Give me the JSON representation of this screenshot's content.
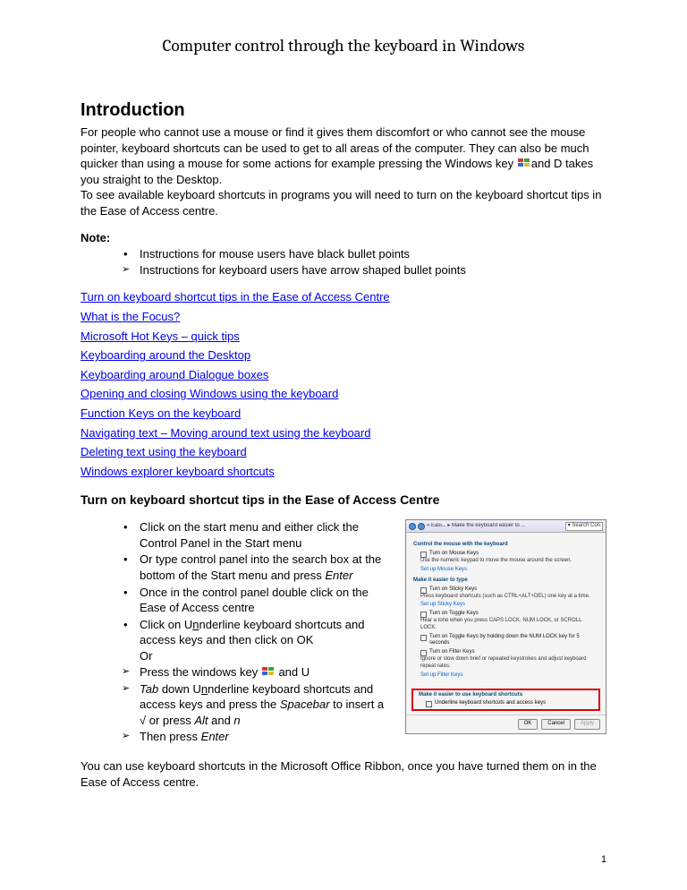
{
  "title": "Computer control through the keyboard in Windows",
  "intro_heading": "Introduction",
  "intro_p1_a": "For people who cannot use a mouse or find it gives them discomfort or who cannot see the mouse pointer, keyboard shortcuts can be used to get to all areas of the computer. They can also be much quicker than using a mouse for some actions for example pressing the Windows key ",
  "intro_p1_b": "and D takes you straight to the Desktop.",
  "intro_p2": "To see available keyboard shortcuts in programs you will need to turn on the keyboard shortcut tips in the Ease of Access centre.",
  "note_label": "Note:",
  "note_items": [
    "Instructions for mouse users have black bullet points",
    "Instructions for keyboard users have arrow shaped bullet points"
  ],
  "toc": [
    "Turn on keyboard shortcut tips in the Ease of Access Centre",
    "What is the Focus?",
    "Microsoft Hot Keys – quick tips",
    "Keyboarding around the Desktop",
    "Keyboarding around Dialogue boxes",
    "Opening and closing Windows using the keyboard",
    "Function Keys on the keyboard",
    "Navigating text – Moving around text using the keyboard",
    "Deleting text using the keyboard",
    "Windows explorer keyboard shortcuts"
  ],
  "section_heading": "Turn on keyboard shortcut tips in the Ease of Access Centre",
  "steps_mouse": {
    "s1": "Click on the start menu and either click  the Control Panel in the Start menu",
    "s2_a": "Or type control panel into the search box at the bottom of the Start menu and press ",
    "s2_b": "Enter",
    "s3": "Once in the control panel double click on the Ease of Access centre",
    "s4_a": "Click on U",
    "s4_b": "nderline  keyboard shortcuts and access keys and then click on OK",
    "s4_c": "Or"
  },
  "steps_kbd": {
    "s5_a": "Press the windows key ",
    "s5_b": " and U",
    "s6_a": "Tab",
    "s6_b": " down U",
    "s6_c": "nderline  keyboard shortcuts and access keys and press the  ",
    "s6_d": "Spacebar",
    "s6_e": " to insert a √ or press ",
    "s6_f": "Alt",
    "s6_g": " and ",
    "s6_h": "n",
    "s7_a": "Then press ",
    "s7_b": "Enter"
  },
  "screenshot": {
    "titlebar": "« Easi...  ▸  Make the keyboard easier to ...",
    "search": "Search Con",
    "g1": "Control the mouse with the keyboard",
    "g1_c": "Turn on Mouse Keys",
    "g1_d": "Use the numeric keypad to move the mouse around the screen.",
    "g1_l": "Set up Mouse Keys",
    "g2": "Make it easier to type",
    "g2_c": "Turn on Sticky Keys",
    "g2_d": "Press keyboard shortcuts (such as CTRL+ALT+DEL) one key at a time.",
    "g2_l": "Set up Sticky Keys",
    "g2_c2": "Turn on Toggle Keys",
    "g2_d2a": "Hear a tone when you press CAPS LOCK, NUM LOCK, or SCROLL LOCK.",
    "g2_d2b": "Turn on Toggle Keys by holding down the NUM LOCK key for 5 seconds",
    "g2_c3": "Turn on Filter Keys",
    "g2_d3": "Ignore or slow down brief or repeated keystrokes and adjust keyboard repeat rates.",
    "g2_l3": "Set up Filter Keys",
    "g3": "Make it easier to use keyboard shortcuts",
    "g3_c": "Underline keyboard shortcuts and access keys",
    "btn_ok": "OK",
    "btn_cancel": "Cancel",
    "btn_apply": "Apply"
  },
  "footer_text": "You can use keyboard shortcuts in the Microsoft Office Ribbon, once you have turned them on in the Ease of Access centre.",
  "page_number": "1"
}
